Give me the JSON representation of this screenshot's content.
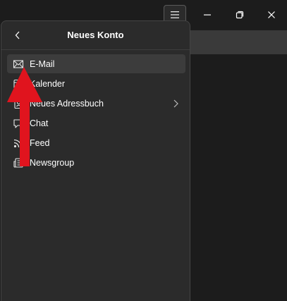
{
  "window": {
    "menu_icon": "hamburger-menu-icon",
    "minimize_icon": "minimize-icon",
    "restore_icon": "restore-icon",
    "close_icon": "close-icon"
  },
  "panel": {
    "title": "Neues Konto",
    "back_icon": "chevron-left-icon",
    "items": [
      {
        "label": "E-Mail",
        "icon": "mail-icon",
        "selected": true,
        "has_submenu": false
      },
      {
        "label": "Kalender",
        "icon": "calendar-icon",
        "selected": false,
        "has_submenu": false
      },
      {
        "label": "Neues Adressbuch",
        "icon": "address-book-icon",
        "selected": false,
        "has_submenu": true
      },
      {
        "label": "Chat",
        "icon": "chat-icon",
        "selected": false,
        "has_submenu": false
      },
      {
        "label": "Feed",
        "icon": "feed-icon",
        "selected": false,
        "has_submenu": false
      },
      {
        "label": "Newsgroup",
        "icon": "newsgroup-icon",
        "selected": false,
        "has_submenu": false
      }
    ]
  },
  "annotation": {
    "arrow_color": "#e0141e",
    "points_to": "E-Mail"
  },
  "colors": {
    "background": "#1c1c1c",
    "panel": "#2b2b2b",
    "selected_row": "#3c3c3c"
  }
}
